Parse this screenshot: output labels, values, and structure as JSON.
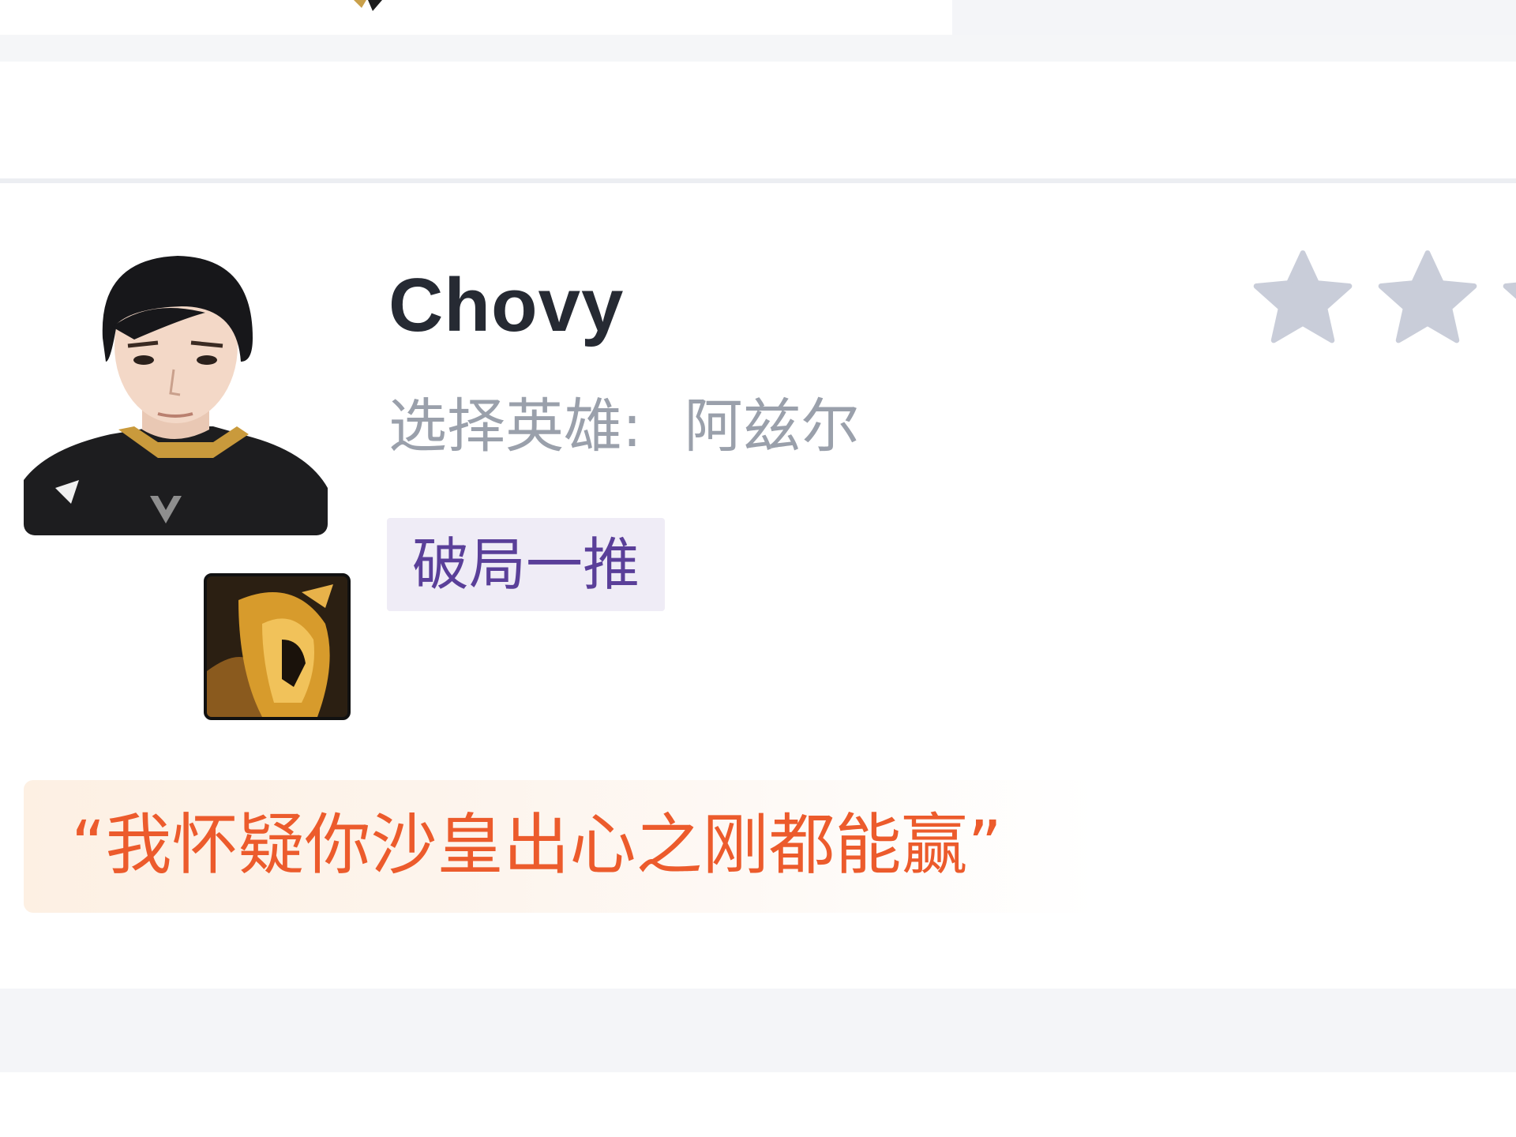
{
  "player": {
    "name": "Chovy",
    "hero_label": "选择英雄:",
    "hero_name": "阿兹尔",
    "tag": "破局一推",
    "quote": "“我怀疑你沙皇出心之刚都能赢”"
  },
  "rating": {
    "visible_stars": 3
  },
  "colors": {
    "name": "#262a33",
    "muted": "#9aa0ab",
    "tag_text": "#5a3f99",
    "tag_bg": "#efecf6",
    "quote_text": "#ec5b2c",
    "star": "#c9cdd9"
  },
  "icons": [
    "player-avatar",
    "azir-hero-icon",
    "star-icon",
    "team-logo-icon"
  ]
}
